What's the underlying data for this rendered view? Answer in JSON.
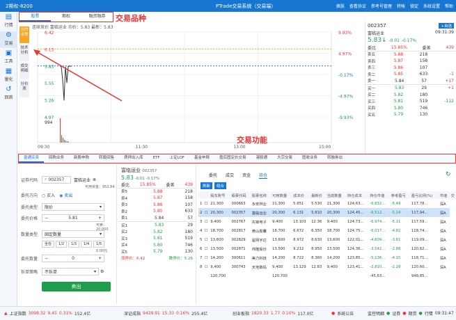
{
  "app": {
    "account": "2期权-8200",
    "title": "PTrade交易系统（交易端）",
    "menu": [
      "换肤",
      "查看协议",
      "参考号管理",
      "转帐",
      "锁定",
      "系统设置",
      "帮助"
    ]
  },
  "sidenav": [
    {
      "icon": "chart-icon",
      "label": "行情"
    },
    {
      "icon": "trade-icon",
      "label": "交易"
    },
    {
      "icon": "toolbox-icon",
      "label": "工具"
    },
    {
      "icon": "quant-icon",
      "label": "量化"
    },
    {
      "icon": "back-icon",
      "label": "回首"
    }
  ],
  "product_tabs": [
    "股票",
    "期权",
    "融资融券"
  ],
  "annotation_product": "交易品种",
  "annotation_function": "交易功能",
  "vtabs": [
    "分时走势",
    "技术分析",
    "成交明细",
    "分价表"
  ],
  "chart_info": {
    "text": "连续竞价  富临运业  均价：5.83  最新：5.83"
  },
  "chart_data": {
    "type": "line",
    "title": "富临运业",
    "y_left_ticks": [
      "6.42",
      "6.13",
      "5.83",
      "5.55",
      "5.26",
      "4.97"
    ],
    "y_right_ticks": [
      "9.93%",
      "4.97%",
      "-0.17%",
      "-4.97%",
      "-9.93%"
    ],
    "x_ticks": [
      "09:30",
      "11:30",
      "13:00",
      "15:00"
    ],
    "volume_label": "994",
    "prev_close": 5.84,
    "ylim": [
      4.97,
      6.42
    ],
    "series": [
      {
        "values": [
          5.84,
          5.83,
          5.6,
          5.25,
          5.83,
          5.55,
          5.83,
          5.84,
          5.83
        ]
      }
    ],
    "volume": [
      994,
      300,
      200,
      120,
      80,
      60,
      40
    ]
  },
  "quote_panel": {
    "code": "002357",
    "name": "富临运业",
    "time": "09:31:39",
    "button": "+自选",
    "price": "5.83",
    "change": "-0.01",
    "pct": "-0.17%",
    "weibi_label": "委比",
    "weibi": "15.85%",
    "weicha_label": "委差",
    "weicha": "439",
    "asks": [
      {
        "lvl": "卖五",
        "price": "5.88",
        "vol": "218",
        "chg": ""
      },
      {
        "lvl": "卖四",
        "price": "5.87",
        "vol": "158",
        "chg": ""
      },
      {
        "lvl": "卖三",
        "price": "5.86",
        "vol": "107",
        "chg": ""
      },
      {
        "lvl": "卖二",
        "price": "5.85",
        "vol": "633",
        "chg": "-1"
      },
      {
        "lvl": "卖一",
        "price": "5.84",
        "vol": "57",
        "chg": "+17"
      }
    ],
    "bids": [
      {
        "lvl": "买一",
        "price": "5.83",
        "vol": "29",
        "chg": "+1"
      },
      {
        "lvl": "买二",
        "price": "5.82",
        "vol": "180",
        "chg": ""
      },
      {
        "lvl": "买三",
        "price": "5.81",
        "vol": "519",
        "chg": "-112"
      },
      {
        "lvl": "买四",
        "price": "5.80",
        "vol": "746",
        "chg": ""
      },
      {
        "lvl": "买五",
        "price": "5.79",
        "vol": "130",
        "chg": ""
      }
    ]
  },
  "function_tabs": [
    "普通买卖",
    "回购业务",
    "新股申购",
    "转股回售",
    "质押出入库",
    "ETF",
    "上证LOF",
    "基金申赎",
    "盘后固定价交易",
    "港股通",
    "大宗交易",
    "固收业务",
    "转融券出"
  ],
  "order_form": {
    "code_label": "证券代码",
    "code": "002357",
    "name": "富临运业",
    "avail": "可用资金：952.84",
    "dir_label": "委托方向",
    "buy": "买入",
    "sell": "卖出",
    "type_label": "委托类型",
    "type": "限价",
    "price_label": "委托价格",
    "price": "5.81",
    "max_label": "可卖：20,000",
    "qty_type_label": "数量类型",
    "qty_type": "固定数量",
    "qty_btns": [
      "全仓",
      "1/2",
      "1/3",
      "1/4",
      "1/5"
    ],
    "amount": "0.00元",
    "qty_label": "委托数量",
    "qty": "0",
    "split_label": "拆单策略",
    "split": "不拆单",
    "submit": "卖出"
  },
  "mid_book": {
    "name": "富临运业",
    "code": "002357",
    "price": "5.83",
    "change": "-0.01",
    "pct": "-0.17%",
    "weibi_label": "委比",
    "weibi": "15.85%",
    "weicha_label": "委差",
    "weicha": "439",
    "asks": [
      {
        "lvl": "卖5",
        "price": "5.88",
        "vol": "218"
      },
      {
        "lvl": "卖4",
        "price": "5.87",
        "vol": "158"
      },
      {
        "lvl": "卖3",
        "price": "5.86",
        "vol": "107"
      },
      {
        "lvl": "卖2",
        "price": "5.85",
        "vol": "633"
      },
      {
        "lvl": "卖1",
        "price": "5.84",
        "vol": "57"
      }
    ],
    "bids": [
      {
        "lvl": "买1",
        "price": "5.83",
        "vol": "29"
      },
      {
        "lvl": "买2",
        "price": "5.82",
        "vol": "180"
      },
      {
        "lvl": "买3",
        "price": "5.81",
        "vol": "519"
      },
      {
        "lvl": "买4",
        "price": "5.80",
        "vol": "746"
      },
      {
        "lvl": "买5",
        "price": "5.79",
        "vol": "130"
      }
    ],
    "footer_a": "涨停价：6.42",
    "footer_b": "跌停价：5.26"
  },
  "position_tabs": [
    "委托",
    "成交",
    "资金",
    "持仓"
  ],
  "position_btns": [
    "刷新",
    "组合"
  ],
  "positions": {
    "headers": [
      "",
      "",
      "股东账号",
      "股票代码",
      "股票名称",
      "可用数量",
      "成本价",
      "最新价",
      "当前数量",
      "持仓成本",
      "持仓市值",
      "参考盈亏",
      "盈亏比例(%)",
      "市值",
      "交"
    ],
    "rows": [
      [
        "1",
        "☐",
        "21,300",
        "000663",
        "永安林业",
        "21,300",
        "5.851",
        "5.530",
        "21,300",
        "124,63...",
        "-6,832...",
        "-5.49",
        "117,78...",
        "深A"
      ],
      [
        "2",
        "☐",
        "20,300",
        "002357",
        "富临运业",
        "20,300",
        "6.131",
        "5.810",
        "20,300",
        "124,45...",
        "-6,512...",
        "-5.24",
        "117,94...",
        "深A"
      ],
      [
        "3",
        "☐",
        "9,400",
        "002767",
        "先锋电子",
        "9,400",
        "13.103",
        "12.36",
        "9,400",
        "124,73...",
        "-6,974...",
        "-5.11",
        "117,59...",
        "深A"
      ],
      [
        "4",
        "☐",
        "18,700",
        "002817",
        "黄山胶囊",
        "18,700",
        "6.672",
        "6.350",
        "18,700",
        "124,75...",
        "-6,017...",
        "-4.82",
        "118,74...",
        "深A"
      ],
      [
        "5",
        "☐",
        "13,600",
        "002829",
        "星网宇达",
        "13,600",
        "8.972",
        "8.630",
        "13,600",
        "122,01...",
        "-4,609...",
        "-3.61",
        "119,09...",
        "深A"
      ],
      [
        "6",
        "☐",
        "13,500",
        "002871",
        "伟隆股份",
        "13,500",
        "9.212",
        "8.950",
        "13,500",
        "124,36...",
        "-3,542...",
        "-2.88",
        "120,82...",
        "深A"
      ],
      [
        "7",
        "☐",
        "14,200",
        "300611",
        "美力科技",
        "14,200",
        "8.722",
        "8.360",
        "14,200",
        "123,85...",
        "-5,136...",
        "-4.15",
        "118,71...",
        "深A"
      ],
      [
        "8",
        "☐",
        "9,400",
        "300743",
        "天地数码",
        "9,400",
        "13.129",
        "12.83",
        "9,400",
        "123,41...",
        "-2,810...",
        "-2.28",
        "120,60...",
        "深A"
      ]
    ],
    "total": [
      "",
      "",
      "120,700",
      "",
      "",
      "120,700",
      "",
      "",
      "",
      "",
      "-45,63...",
      "",
      "948,85...",
      ""
    ]
  },
  "status": {
    "q1_name": "上证指数",
    "q1_val": "3098.32",
    "q1_chg": "9.45",
    "q1_pct": "0.31%",
    "q1_amt": "152.4亿",
    "q2_name": "深证成指",
    "q2_val": "9439.91",
    "q2_chg": "15.33",
    "q2_pct": "0.16%",
    "q2_amt": "255.4亿",
    "q3_name": "创业板指",
    "q3_val": "1820.33",
    "q3_chg": "1.77",
    "q3_pct": "0.10%",
    "q3_amt": "117.0亿",
    "notice": "系统公告",
    "sys": "监控明细",
    "s1": "证券",
    "s2": "期货",
    "s3": "行情",
    "time": "09:31:47"
  },
  "colors": {
    "accent": "#1776d2",
    "up": "#e33333",
    "down": "#1e9e4a",
    "annot": "#e33333"
  }
}
